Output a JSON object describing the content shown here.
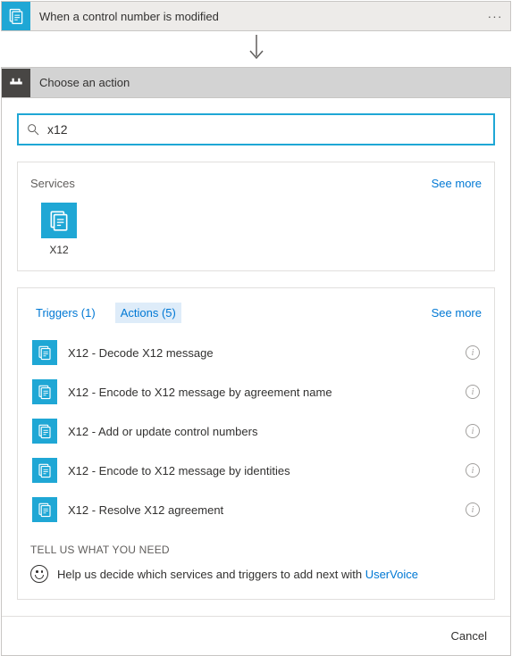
{
  "trigger": {
    "title": "When a control number is modified"
  },
  "chooser": {
    "title": "Choose an action"
  },
  "search": {
    "value": "x12",
    "placeholder": ""
  },
  "services": {
    "heading": "Services",
    "see_more": "See more",
    "items": [
      {
        "label": "X12"
      }
    ]
  },
  "results": {
    "tabs": {
      "triggers": "Triggers (1)",
      "actions": "Actions (5)"
    },
    "see_more": "See more",
    "actions": [
      {
        "label": "X12 - Decode X12 message"
      },
      {
        "label": "X12 - Encode to X12 message by agreement name"
      },
      {
        "label": "X12 - Add or update control numbers"
      },
      {
        "label": "X12 - Encode to X12 message by identities"
      },
      {
        "label": "X12 - Resolve X12 agreement"
      }
    ]
  },
  "feedback": {
    "heading": "TELL US WHAT YOU NEED",
    "text": "Help us decide which services and triggers to add next with ",
    "link": "UserVoice"
  },
  "footer": {
    "cancel": "Cancel"
  }
}
